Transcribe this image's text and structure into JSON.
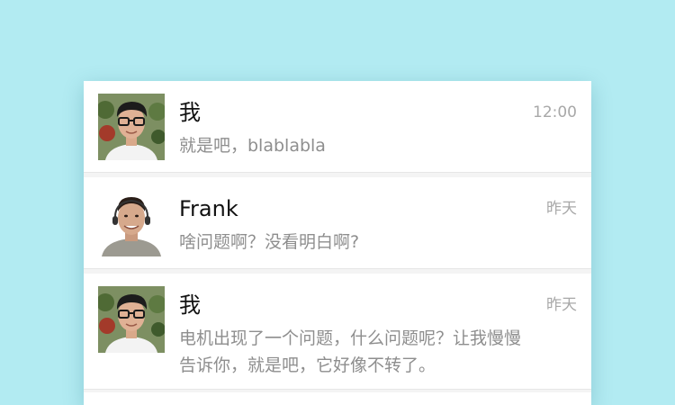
{
  "conversations": [
    {
      "name": "我",
      "time": "12:00",
      "preview": "就是吧，blablabla",
      "avatar": "avatar-photo-glasses-man"
    },
    {
      "name": "Frank",
      "time": "昨天",
      "preview": "啥问题啊？没看明白啊?",
      "avatar": "avatar-photo-headset-man"
    },
    {
      "name": "我",
      "time": "昨天",
      "preview": "电机出现了一个问题，什么问题呢？让我慢慢告诉你，就是吧，它好像不转了。",
      "avatar": "avatar-photo-glasses-man"
    }
  ],
  "colors": {
    "background": "#b2ebf2",
    "name": "#111111",
    "preview": "#8e8e8e",
    "time": "#a8a8a8"
  }
}
